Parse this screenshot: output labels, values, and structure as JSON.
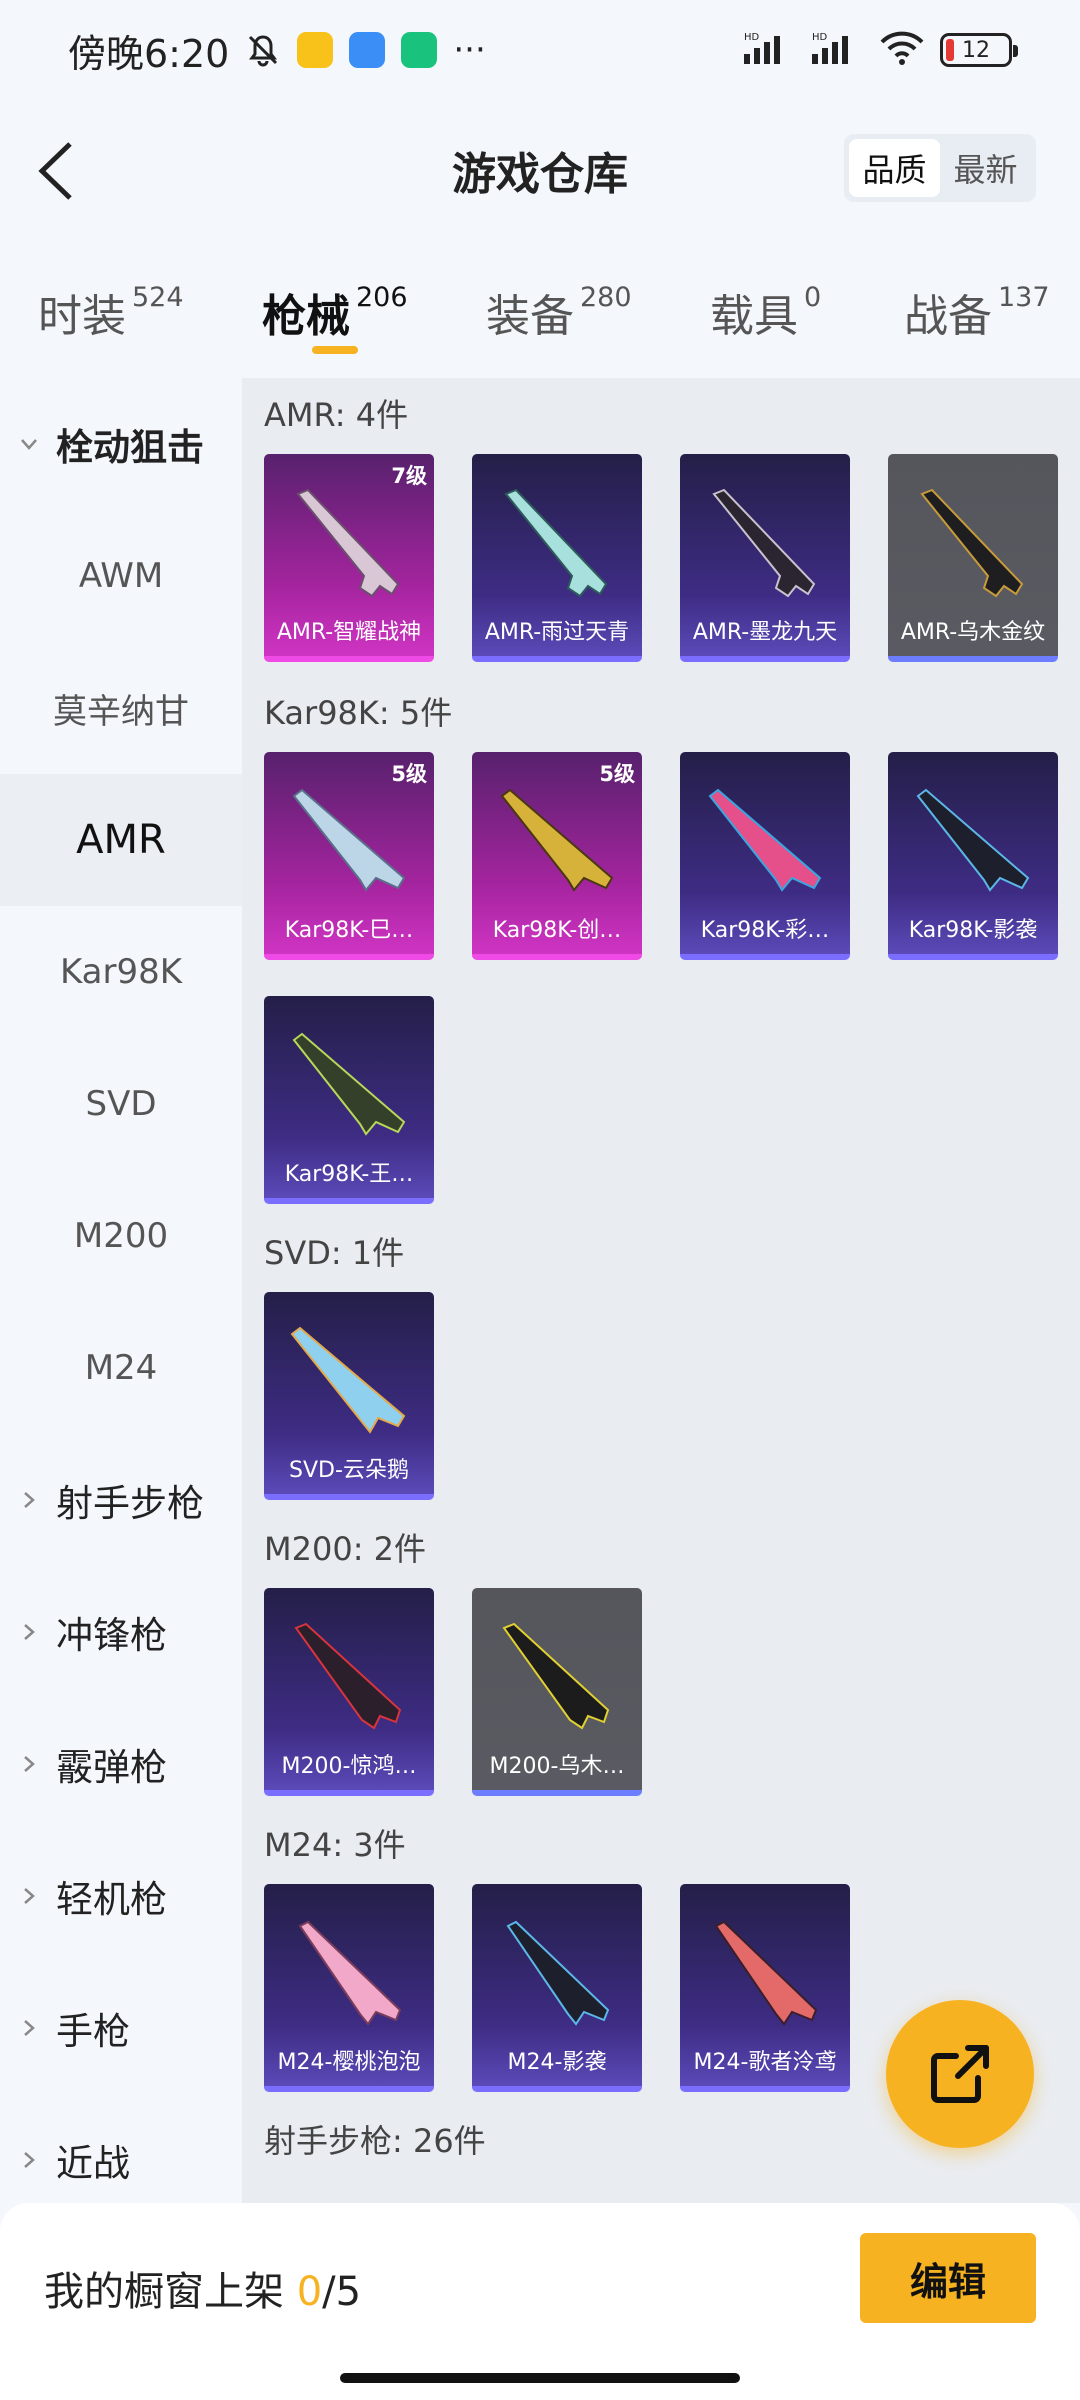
{
  "status_bar": {
    "time": "傍晚6:20",
    "battery": "12"
  },
  "header": {
    "title": "游戏仓库",
    "sort_options": [
      "品质",
      "最新"
    ],
    "sort_active": "品质"
  },
  "tabs": [
    {
      "label": "时装",
      "count": "524"
    },
    {
      "label": "枪械",
      "count": "206"
    },
    {
      "label": "装备",
      "count": "280"
    },
    {
      "label": "载具",
      "count": "0"
    },
    {
      "label": "战备",
      "count": "137"
    }
  ],
  "sidebar": {
    "items": [
      {
        "label": "栓动狙击"
      },
      {
        "label": "AWM"
      },
      {
        "label": "莫辛纳甘"
      },
      {
        "label": "AMR"
      },
      {
        "label": "Kar98K"
      },
      {
        "label": "SVD"
      },
      {
        "label": "M200"
      },
      {
        "label": "M24"
      },
      {
        "label": "射手步枪"
      },
      {
        "label": "冲锋枪"
      },
      {
        "label": "霰弹枪"
      },
      {
        "label": "轻机枪"
      },
      {
        "label": "手枪"
      },
      {
        "label": "近战"
      }
    ]
  },
  "sections": [
    {
      "label": "AMR: 4件",
      "items": [
        {
          "name": "AMR-智耀战神",
          "level": "7级",
          "rarity": "pink"
        },
        {
          "name": "AMR-雨过天青",
          "level": "",
          "rarity": "purple"
        },
        {
          "name": "AMR-墨龙九天",
          "level": "",
          "rarity": "purple"
        },
        {
          "name": "AMR-乌木金纹",
          "level": "",
          "rarity": "gray"
        }
      ]
    },
    {
      "label": "Kar98K: 5件",
      "items": [
        {
          "name": "Kar98K-巳…",
          "level": "5级",
          "rarity": "pink"
        },
        {
          "name": "Kar98K-创…",
          "level": "5级",
          "rarity": "pink"
        },
        {
          "name": "Kar98K-彩…",
          "level": "",
          "rarity": "purple"
        },
        {
          "name": "Kar98K-影袭",
          "level": "",
          "rarity": "purple"
        },
        {
          "name": "Kar98K-王…",
          "level": "",
          "rarity": "purple"
        }
      ]
    },
    {
      "label": "SVD: 1件",
      "items": [
        {
          "name": "SVD-云朵鹅",
          "level": "",
          "rarity": "purple"
        }
      ]
    },
    {
      "label": "M200: 2件",
      "items": [
        {
          "name": "M200-惊鸿…",
          "level": "",
          "rarity": "purple"
        },
        {
          "name": "M200-乌木…",
          "level": "",
          "rarity": "gray"
        }
      ]
    },
    {
      "label": "M24: 3件",
      "items": [
        {
          "name": "M24-樱桃泡泡",
          "level": "",
          "rarity": "purple"
        },
        {
          "name": "M24-影袭",
          "level": "",
          "rarity": "purple"
        },
        {
          "name": "M24-歌者泠鸢",
          "level": "",
          "rarity": "purple"
        }
      ]
    },
    {
      "label": "射手步枪: 26件",
      "items": []
    }
  ],
  "bottom": {
    "label": "我的橱窗上架",
    "count_current": "0",
    "count_total": "/5",
    "edit_label": "编辑"
  },
  "colors": {
    "accent": "#f6b220",
    "pink_card": "#cf34c3",
    "purple_card": "#3e2c84",
    "gray_card": "#5a5b62"
  }
}
